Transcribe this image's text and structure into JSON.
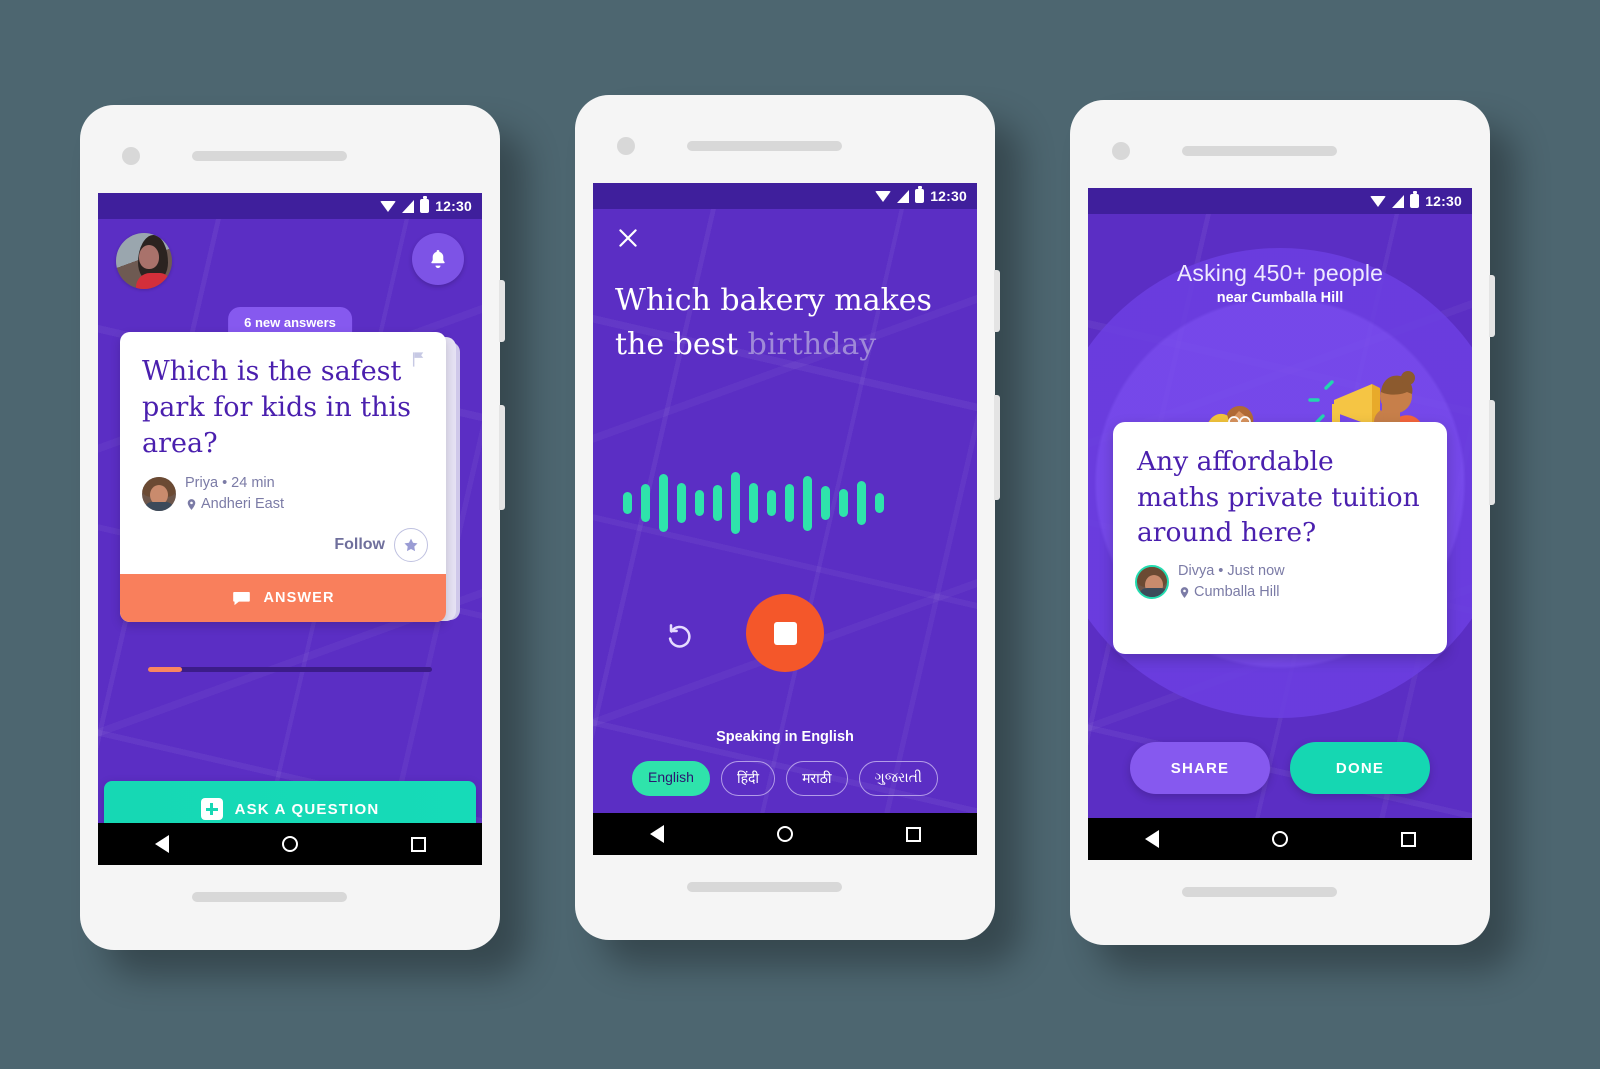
{
  "theme": {
    "bg": "#4d6670",
    "purple": "#5b2ec4",
    "purple_dark": "#3f1f9c",
    "purple_light": "#8659ef",
    "teal": "#16d8b4",
    "orange": "#f97f5c",
    "orange_deep": "#f4572a",
    "serif_purple": "#4a1fae"
  },
  "statusbar": {
    "time": "12:30",
    "wifi_icon": "wifi-icon",
    "signal_icon": "signal-icon",
    "battery_icon": "battery-icon"
  },
  "navbar": {
    "back": "back-nav-icon",
    "home": "home-nav-icon",
    "recents": "recents-nav-icon"
  },
  "screen1": {
    "avatar_alt": "user-avatar",
    "bell_icon": "bell-icon",
    "new_answers_badge": "6 new answers",
    "card": {
      "question": "Which is the safest park for kids in this area?",
      "flag_icon": "flag-icon",
      "author": "Priya • 24 min",
      "location": "Andheri East",
      "location_icon": "location-pin-icon",
      "follow_label": "Follow",
      "follow_icon": "star-icon",
      "answer_label": "ANSWER",
      "answer_icon": "chat-bubble-icon"
    },
    "progress_percent": 12,
    "ask_button": {
      "label": "ASK A QUESTION",
      "icon": "plus-square-icon"
    }
  },
  "screen2": {
    "close_icon": "close-icon",
    "transcript_confirmed": "Which bakery makes the best",
    "transcript_pending": "birthday",
    "waveform": [
      22,
      38,
      58,
      40,
      26,
      36,
      62,
      40,
      26,
      38,
      55,
      34,
      28,
      44,
      20
    ],
    "undo_icon": "undo-icon",
    "stop_button": {
      "icon": "stop-square-icon",
      "name": "stop-recording-button"
    },
    "speaking_label": "Speaking in English",
    "languages": [
      {
        "label": "English",
        "active": true
      },
      {
        "label": "हिंदी",
        "active": false
      },
      {
        "label": "मराठी",
        "active": false
      },
      {
        "label": "ગુજરાતી",
        "active": false
      }
    ]
  },
  "screen3": {
    "headline": "Asking 450+ people",
    "subhead": "near Cumballa Hill",
    "illustration": "people-with-megaphone-illustration",
    "card": {
      "question": "Any affordable maths private tuition around here?",
      "author": "Divya • Just now",
      "location": "Cumballa Hill",
      "location_icon": "location-pin-icon"
    },
    "share_label": "SHARE",
    "done_label": "DONE"
  }
}
